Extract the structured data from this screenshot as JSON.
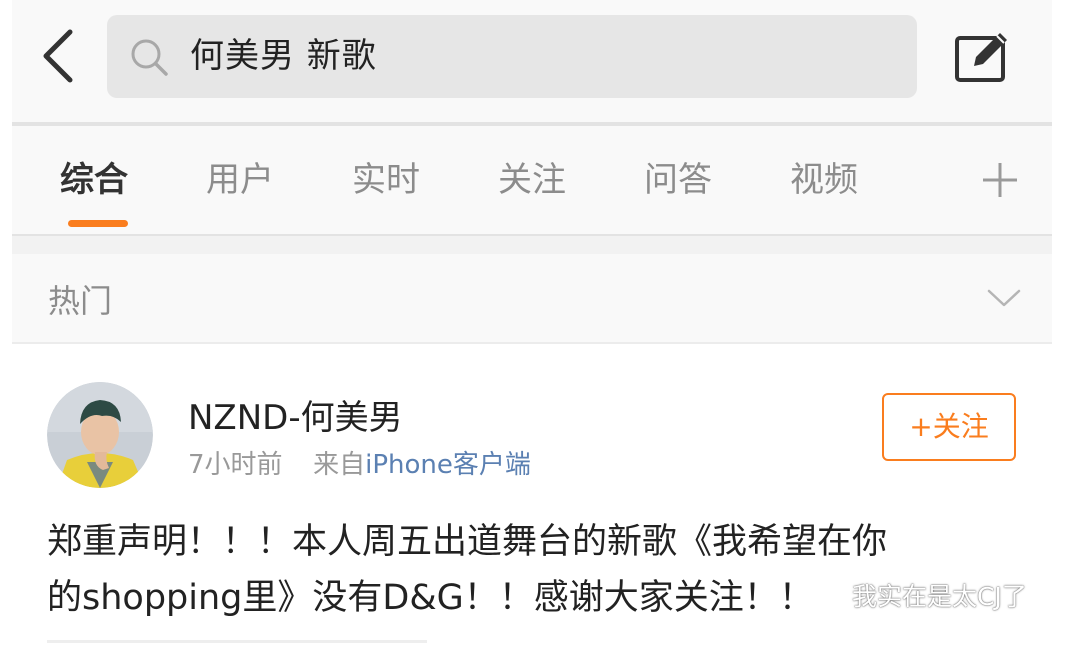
{
  "search": {
    "query": "何美男 新歌"
  },
  "icons": {
    "back": "chevron-left-icon",
    "search": "search-icon",
    "compose": "compose-icon",
    "chevron_down": "chevron-down-icon",
    "plus": "plus-icon"
  },
  "tabs": [
    {
      "label": "综合",
      "active": true
    },
    {
      "label": "用户",
      "active": false
    },
    {
      "label": "实时",
      "active": false
    },
    {
      "label": "关注",
      "active": false
    },
    {
      "label": "问答",
      "active": false
    },
    {
      "label": "视频",
      "active": false
    }
  ],
  "tabs_plus": "+",
  "hot_section": {
    "title": "热门"
  },
  "post": {
    "username": "NZND-何美男",
    "time": "7小时前",
    "from_prefix": "来自",
    "source": "iPhone客户端",
    "follow_label": "+关注",
    "body_line1": "郑重声明！！！本人周五出道舞台的新歌《我希望在你",
    "body_line2": "的shopping里》没有D&G！！感谢大家关注！！"
  },
  "watermark": {
    "text": "我实在是太CJ了"
  },
  "colors": {
    "accent": "#fa7d1e",
    "link": "#5b80b2",
    "muted_text": "#999999"
  }
}
